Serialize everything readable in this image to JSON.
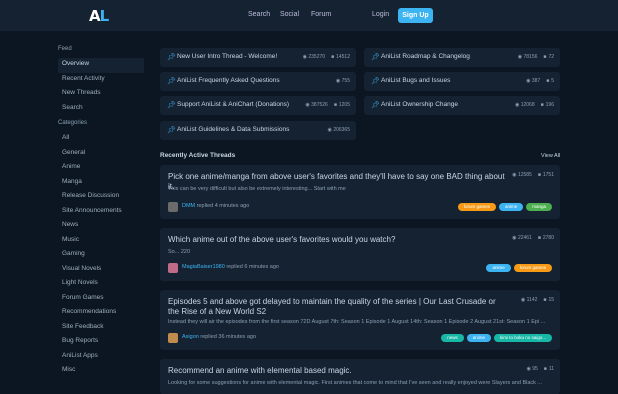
{
  "nav": {
    "links": [
      "Search",
      "Social",
      "Forum"
    ],
    "login": "Login",
    "signup": "Sign Up"
  },
  "sidebar": {
    "feed_heading": "Feed",
    "feed_items": [
      "Overview",
      "Recent Activity",
      "New Threads",
      "Search"
    ],
    "categories_heading": "Categories",
    "categories": [
      "All",
      "General",
      "Anime",
      "Manga",
      "Release Discussion",
      "Site Announcements",
      "News",
      "Music",
      "Gaming",
      "Visual Novels",
      "Light Novels",
      "Forum Games",
      "Recommendations",
      "Site Feedback",
      "Bug Reports",
      "AniList Apps",
      "Misc"
    ]
  },
  "stickies": [
    {
      "title": "New User Intro Thread - Welcome!",
      "views": "235270",
      "replies": "14512"
    },
    {
      "title": "AniList Roadmap & Changelog",
      "views": "78156",
      "replies": "72"
    },
    {
      "title": "AniList Frequently Asked Questions",
      "views": "755",
      "replies": ""
    },
    {
      "title": "AniList Bugs and Issues",
      "views": "387",
      "replies": "5"
    },
    {
      "title": "Support AniList & AniChart (Donations)",
      "views": "387526",
      "replies": "1205"
    },
    {
      "title": "AniList Ownership Change",
      "views": "12068",
      "replies": "196"
    },
    {
      "title": "AniList Guidelines & Data Submissions",
      "views": "206365",
      "replies": ""
    }
  ],
  "recent": {
    "heading": "Recently Active Threads",
    "view_all": "View All"
  },
  "threads": [
    {
      "title": "Pick one anime/manga from above user's favorites and they'll have to say one BAD thing about it.",
      "excerpt": "This can be very difficult but also be extremely interesting... Start with me",
      "views": "12585",
      "replies": "1751",
      "user": "DMM",
      "reply_text": "replied 4 minutes ago",
      "tags": [
        {
          "label": "forum games",
          "color": "#f79a15"
        },
        {
          "label": "anime",
          "color": "#3db4f2"
        },
        {
          "label": "manga",
          "color": "#4caf50"
        }
      ]
    },
    {
      "title": "Which anime out of the above user's favorites would you watch?",
      "excerpt": "So... 220",
      "views": "22461",
      "replies": "2780",
      "user": "MagiaBaiser1980",
      "reply_text": "replied 6 minutes ago",
      "tags": [
        {
          "label": "anime",
          "color": "#3db4f2"
        },
        {
          "label": "forum games",
          "color": "#f79a15"
        }
      ]
    },
    {
      "title": "Episodes 5 and above got delayed to maintain the quality of the series | Our Last Crusade or the Rise of a New World S2",
      "excerpt": "Instead they will air the episodes from the first season 72D August 7th: Season 1 Episode 1 August 14th: Season 1 Episode 2 August 21st: Season 1 Epi ...",
      "views": "1142",
      "replies": "15",
      "user": "Asigon",
      "reply_text": "replied 36 minutes ago",
      "tags": [
        {
          "label": "news",
          "color": "#17b8a6"
        },
        {
          "label": "anime",
          "color": "#3db4f2"
        },
        {
          "label": "kimi to boku no saigo...",
          "color": "#17b8a6"
        }
      ]
    },
    {
      "title": "Recommend an anime with elemental based magic.",
      "excerpt": "Looking for some suggestions for anime with elemental magic. First animes that come to mind that I've seen and really enjoyed were Slayers and Black ...",
      "views": "95",
      "replies": "11",
      "user": "",
      "reply_text": "",
      "tags": []
    }
  ],
  "colors": {
    "bg": "#0b1622",
    "panel": "#152232",
    "accent": "#3db4f2"
  },
  "icons": [
    "pin-icon",
    "eye-icon",
    "comment-icon"
  ]
}
